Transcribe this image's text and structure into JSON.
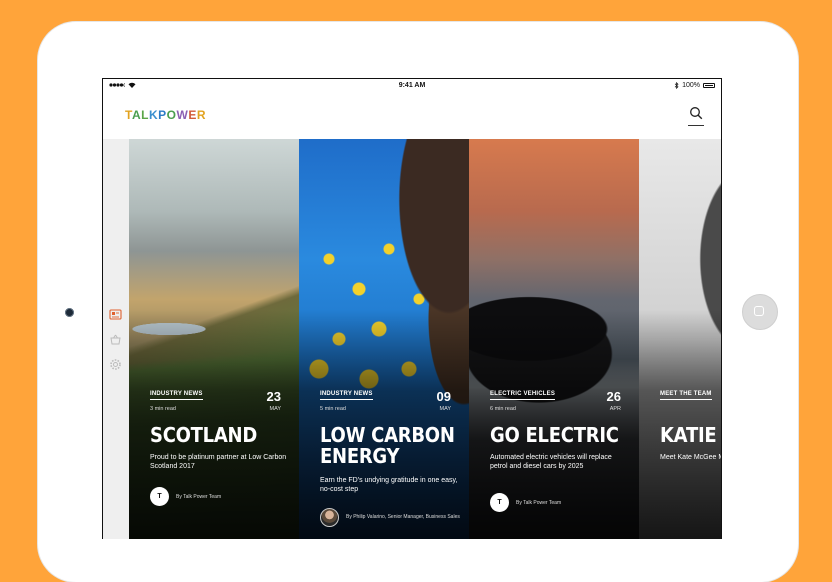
{
  "status_bar": {
    "time": "9:41 AM",
    "battery": "100%"
  },
  "app": {
    "logo_text": "TALKPOWER"
  },
  "cards": [
    {
      "category": "INDUSTRY NEWS",
      "read_time": "3 min read",
      "day": "23",
      "month": "MAY",
      "title": "SCOTLAND",
      "subtitle": "Proud to be platinum partner at Low Carbon Scotland 2017",
      "author_initial": "T",
      "author": "By Talk Power Team"
    },
    {
      "category": "INDUSTRY NEWS",
      "read_time": "5 min read",
      "day": "09",
      "month": "MAY",
      "title": "LOW CARBON ENERGY",
      "subtitle": "Earn the FD's undying gratitude in one easy, no-cost step",
      "author": "By Philip Valarino, Senior Manager, Business Sales"
    },
    {
      "category": "ELECTRIC VEHICLES",
      "read_time": "6 min read",
      "day": "26",
      "month": "APR",
      "title": "GO ELECTRIC",
      "subtitle": "Automated electric vehicles will replace petrol and diesel cars by 2025",
      "author_initial": "T",
      "author": "By Talk Power Team"
    },
    {
      "category": "MEET THE TEAM",
      "title": "KATIE",
      "subtitle": "Meet Kate McGee Manager of busin"
    }
  ],
  "colors": {
    "background": "#FFA43A",
    "accent": "#FFA43A"
  }
}
